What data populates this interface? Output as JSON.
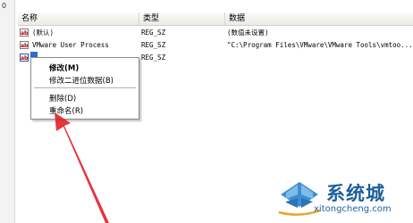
{
  "left_pane": {
    "glyph": "0"
  },
  "header": {
    "name": "名称",
    "type": "类型",
    "data": "数据"
  },
  "rows": [
    {
      "icon": "ab",
      "name": "(默认)",
      "type": "REG_SZ",
      "data": "(数值未设置)"
    },
    {
      "icon": "ab",
      "name": "VMware User Process",
      "type": "REG_SZ",
      "data": "\"C:\\Program Files\\VMware\\VMware Tools\\vmtoo..."
    },
    {
      "icon": "ab",
      "name": "",
      "type": "REG_SZ",
      "data": ""
    }
  ],
  "context_menu": {
    "items": [
      "修改(M)",
      "修改二进位数据(B)",
      "删除(D)",
      "重命名(R)"
    ]
  },
  "watermark": {
    "brand": "系统城",
    "url": "xitongcheng.com"
  },
  "colors": {
    "selection": "#316ac5",
    "arrow": "#e0262a",
    "watermark": "#1d5f9c"
  }
}
